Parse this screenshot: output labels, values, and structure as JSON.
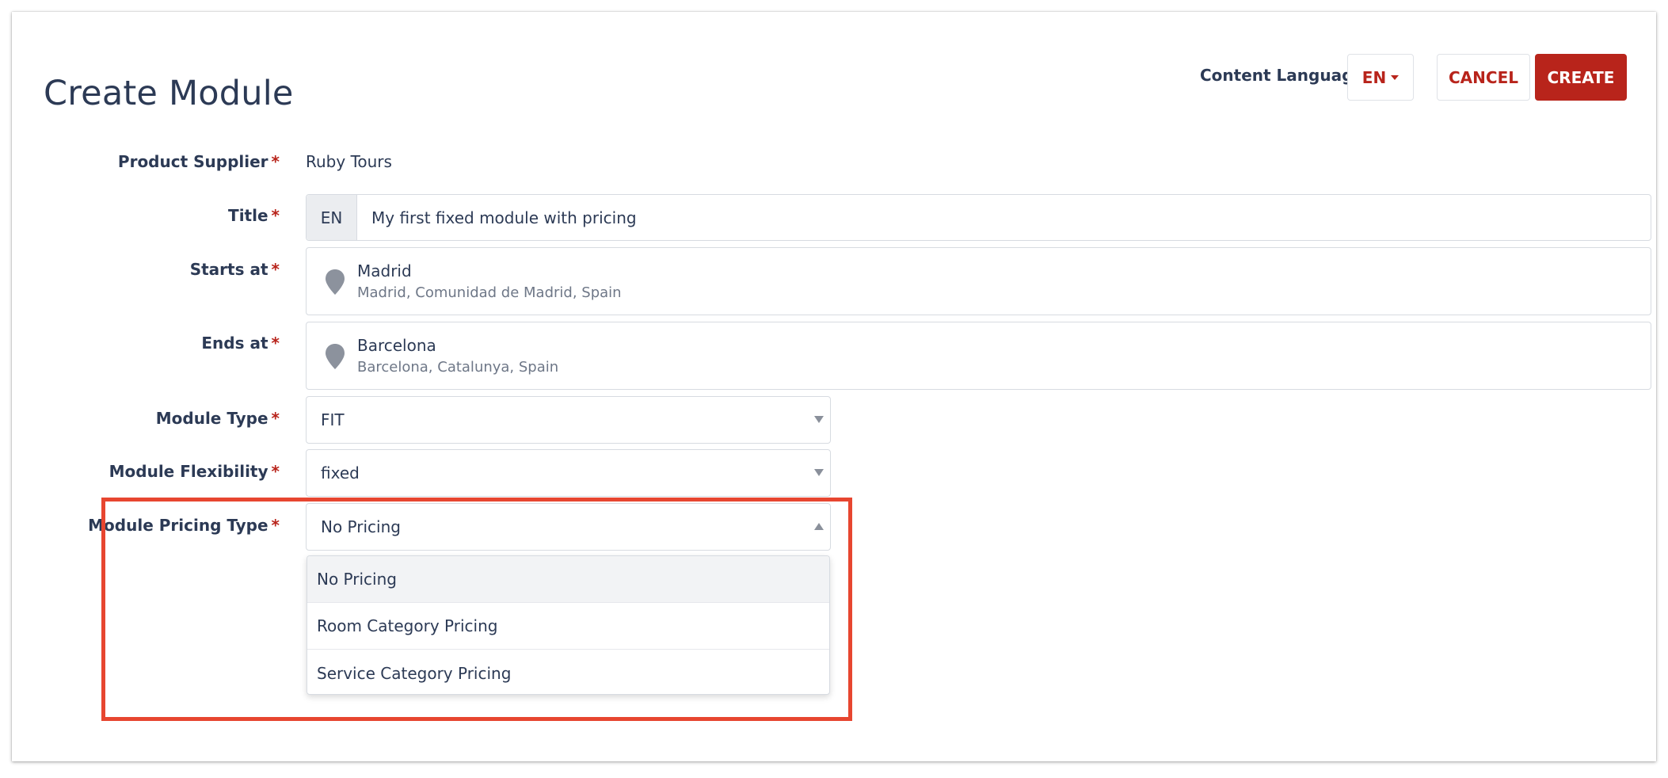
{
  "header": {
    "title": "Create Module",
    "content_language_label": "Content Language",
    "language_value": "EN",
    "cancel_label": "CANCEL",
    "create_label": "CREATE"
  },
  "form": {
    "required_marker": "*",
    "product_supplier": {
      "label": "Product Supplier",
      "value": "Ruby Tours"
    },
    "title": {
      "label": "Title",
      "lang": "EN",
      "value": "My first fixed module with pricing"
    },
    "starts_at": {
      "label": "Starts at",
      "name": "Madrid",
      "detail": "Madrid, Comunidad de Madrid, Spain",
      "icon": "map-pin-icon"
    },
    "ends_at": {
      "label": "Ends at",
      "name": "Barcelona",
      "detail": "Barcelona, Catalunya, Spain",
      "icon": "map-pin-icon"
    },
    "module_type": {
      "label": "Module Type",
      "value": "FIT"
    },
    "module_flexibility": {
      "label": "Module Flexibility",
      "value": "fixed"
    },
    "module_pricing_type": {
      "label": "Module Pricing Type",
      "value": "No Pricing",
      "expanded": true,
      "options": [
        "No Pricing",
        "Room Category Pricing",
        "Service Category Pricing"
      ],
      "active_option": "No Pricing"
    }
  },
  "colors": {
    "accent": "#b8241b",
    "highlight_box": "#e74630",
    "text": "#2c3a55",
    "muted": "#6e7787"
  }
}
